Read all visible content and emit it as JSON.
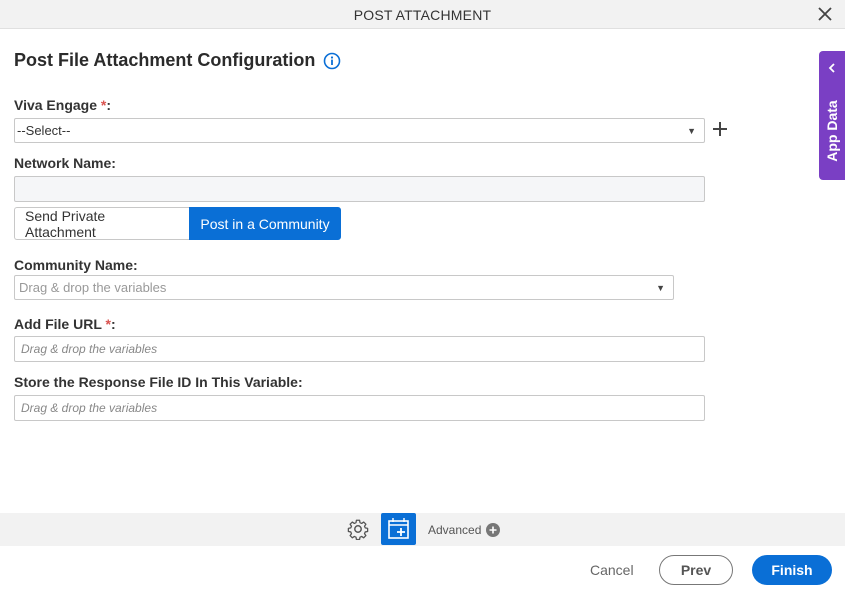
{
  "window": {
    "title": "POST ATTACHMENT",
    "close_icon": "close-icon"
  },
  "form": {
    "heading": "Post File Attachment Configuration",
    "info_icon": "info-icon",
    "viva_engage": {
      "label": "Viva Engage",
      "required_mark": "*",
      "label_suffix": ":",
      "value": "--Select--"
    },
    "network_name": {
      "label": "Network Name:",
      "value": ""
    },
    "toggle": {
      "option_private": "Send Private Attachment",
      "option_community": "Post in a Community",
      "selected": "option_community"
    },
    "community_name": {
      "label": "Community Name:",
      "placeholder": "Drag & drop the variables"
    },
    "file_url": {
      "label": "Add File URL",
      "required_mark": "*",
      "label_suffix": ":",
      "placeholder": "Drag & drop the variables"
    },
    "response_var": {
      "label": "Store the Response File ID In This Variable:",
      "placeholder": "Drag & drop the variables"
    }
  },
  "side_panel": {
    "label": "App Data"
  },
  "toolbar": {
    "advanced_label": "Advanced"
  },
  "footer": {
    "cancel_label": "Cancel",
    "prev_label": "Prev",
    "finish_label": "Finish"
  },
  "colors": {
    "primary": "#0a6fd6",
    "side_panel": "#7a3fc4",
    "required": "#d9534f"
  }
}
